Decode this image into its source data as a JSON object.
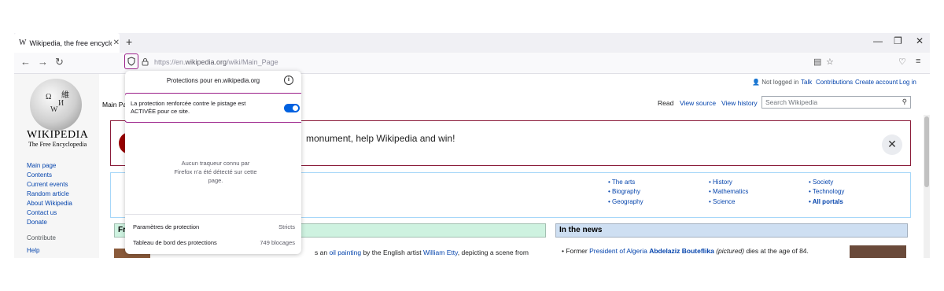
{
  "browser": {
    "tab_title": "Wikipedia, the free encyclopedia",
    "tab_favicon": "W",
    "new_tab": "+",
    "window_controls": [
      "—",
      "❐",
      "✕"
    ],
    "nav_back": "←",
    "nav_forward": "→",
    "nav_reload": "↻",
    "url_prefix": "https://en.",
    "url_domain": "wikipedia.org",
    "url_path": "/wiki/Main_Page",
    "menu": "≡"
  },
  "popup": {
    "title": "Protections pour en.wikipedia.org",
    "status_text": "La protection renforcée contre le pistage est ACTIVÉE pour ce site.",
    "toggle_on": true,
    "empty_text": "Aucun traqueur connu par Firefox n’a été détecté sur cette page.",
    "settings_label": "Paramètres de protection",
    "settings_value": "Stricts",
    "dashboard_label": "Tableau de bord des protections",
    "dashboard_value": "749 blocages",
    "accent_color": "#9a1f89",
    "toggle_color": "#0061e0"
  },
  "wiki": {
    "logo_title": "WIKIPEDIA",
    "logo_subtitle": "The Free Encyclopedia",
    "sidebar": [
      "Main page",
      "Contents",
      "Current events",
      "Random article",
      "About Wikipedia",
      "Contact us",
      "Donate"
    ],
    "contribute_heading": "Contribute",
    "help": "Help",
    "user_status": "Not logged in",
    "user_links": [
      "Talk",
      "Contributions",
      "Create account",
      "Log in"
    ],
    "main_tab": "Main Pa",
    "page_tabs": [
      "Read",
      "View source",
      "View history"
    ],
    "search_placeholder": "Search Wikipedia",
    "banner_text": "monument, help Wikipedia and win!",
    "portals": [
      [
        "The arts",
        "Biography",
        "Geography"
      ],
      [
        "History",
        "Mathematics",
        "Science"
      ],
      [
        "Society",
        "Technology",
        "All portals"
      ]
    ],
    "featured_heading": "Fr",
    "featured_text_pre": "s an ",
    "featured_link1": "oil painting",
    "featured_text_mid": " by the English artist ",
    "featured_link2": "William Etty",
    "featured_text_post": ", depicting a scene from",
    "news_heading": "In the news",
    "news_bullet": "• Former ",
    "news_link1": "President of Algeria",
    "news_bold": "Abdelaziz Bouteflika",
    "news_italic": "(pictured)",
    "news_rest": " dies at the age of 84."
  }
}
